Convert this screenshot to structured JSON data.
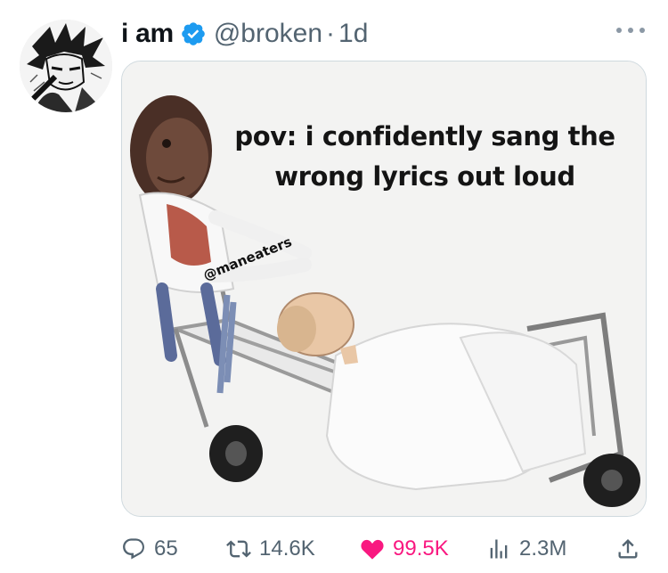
{
  "author": {
    "display_name": "i am",
    "verified": true,
    "handle": "@broken",
    "separator": "·",
    "time_ago": "1d"
  },
  "media": {
    "caption": "pov: i confidently sang the wrong lyrics out loud",
    "watermark": "@maneaters"
  },
  "actions": {
    "replies": "65",
    "reposts": "14.6K",
    "likes": "99.5K",
    "views": "2.3M"
  },
  "icons": {
    "verified": "verified-badge-icon",
    "more": "more-dots-icon",
    "reply": "speech-bubble-icon",
    "repost": "repost-arrows-icon",
    "like": "heart-icon",
    "views": "bar-chart-icon",
    "share": "share-upload-icon"
  },
  "colors": {
    "like_active": "#f91880",
    "verified_blue": "#1d9bf0",
    "secondary_text": "#536471",
    "border": "#cfd9de"
  }
}
